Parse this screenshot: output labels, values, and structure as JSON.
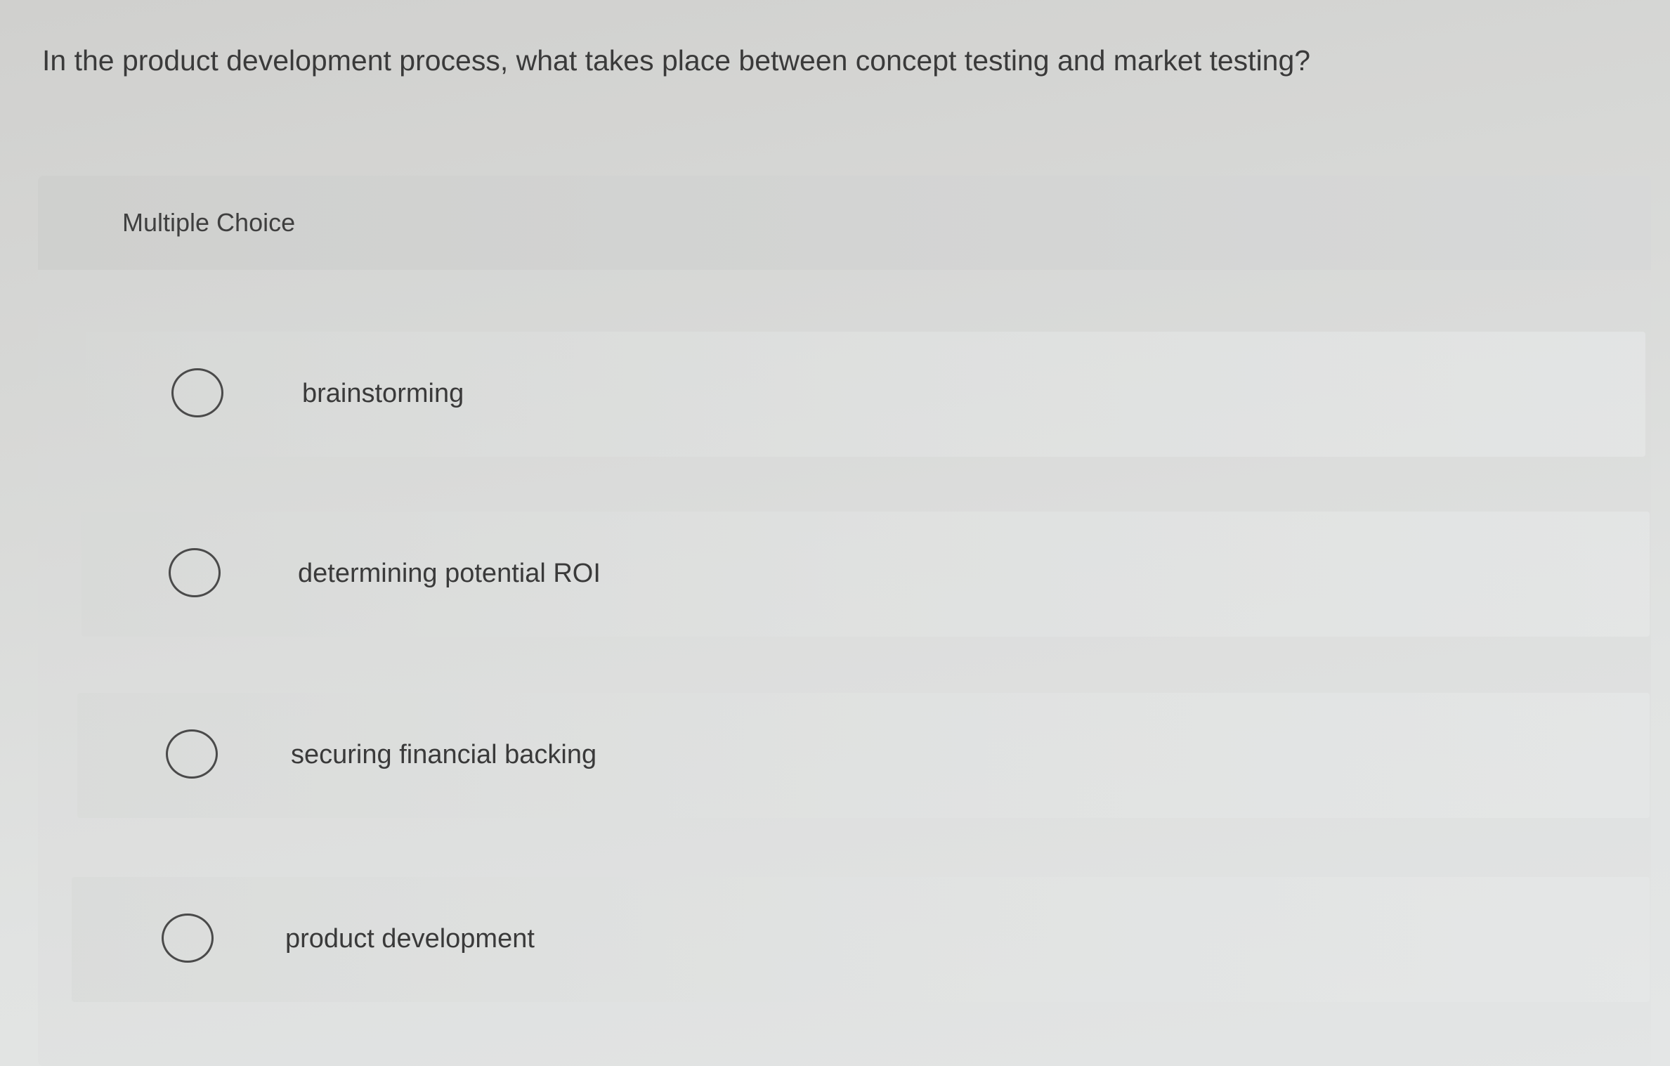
{
  "question": {
    "text": "In the product development process, what takes place between concept testing and market testing?"
  },
  "quiz": {
    "type_label": "Multiple Choice",
    "options": [
      {
        "label": "brainstorming"
      },
      {
        "label": "determining potential ROI"
      },
      {
        "label": "securing financial backing"
      },
      {
        "label": "product development"
      }
    ]
  }
}
